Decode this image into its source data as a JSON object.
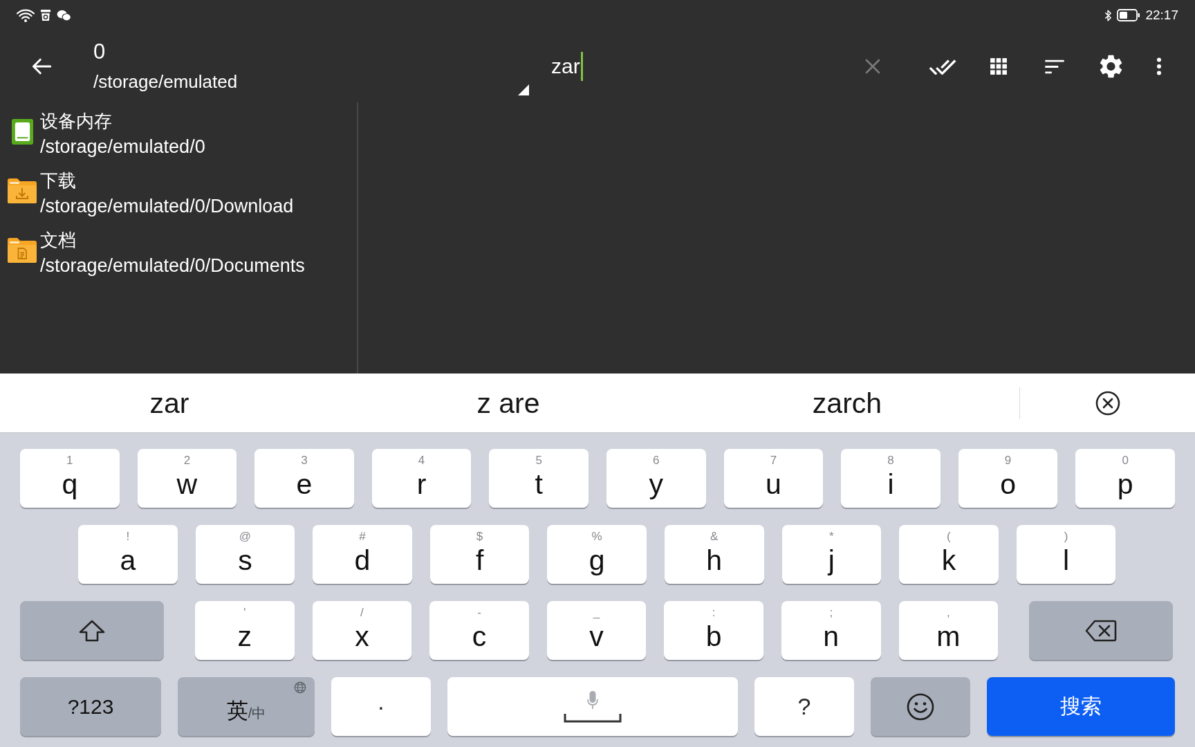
{
  "status_bar": {
    "time": "22:17"
  },
  "toolbar": {
    "title": "0",
    "subtitle": "/storage/emulated",
    "search": {
      "value": "zar"
    }
  },
  "sidebar": {
    "items": [
      {
        "kind": "storage",
        "title": "设备内存",
        "path": "/storage/emulated/0"
      },
      {
        "kind": "download",
        "title": "下载",
        "path": "/storage/emulated/0/Download"
      },
      {
        "kind": "documents",
        "title": "文档",
        "path": "/storage/emulated/0/Documents"
      }
    ]
  },
  "keyboard": {
    "suggestions": [
      "zar",
      "z are",
      "zarch"
    ],
    "rows": [
      [
        {
          "kind": "letter",
          "label": "q",
          "hint": "1"
        },
        {
          "kind": "letter",
          "label": "w",
          "hint": "2"
        },
        {
          "kind": "letter",
          "label": "e",
          "hint": "3"
        },
        {
          "kind": "letter",
          "label": "r",
          "hint": "4"
        },
        {
          "kind": "letter",
          "label": "t",
          "hint": "5"
        },
        {
          "kind": "letter",
          "label": "y",
          "hint": "6"
        },
        {
          "kind": "letter",
          "label": "u",
          "hint": "7"
        },
        {
          "kind": "letter",
          "label": "i",
          "hint": "8"
        },
        {
          "kind": "letter",
          "label": "o",
          "hint": "9"
        },
        {
          "kind": "letter",
          "label": "p",
          "hint": "0"
        }
      ],
      [
        {
          "kind": "letter",
          "label": "a",
          "hint": "!"
        },
        {
          "kind": "letter",
          "label": "s",
          "hint": "@"
        },
        {
          "kind": "letter",
          "label": "d",
          "hint": "#"
        },
        {
          "kind": "letter",
          "label": "f",
          "hint": "$"
        },
        {
          "kind": "letter",
          "label": "g",
          "hint": "%"
        },
        {
          "kind": "letter",
          "label": "h",
          "hint": "&"
        },
        {
          "kind": "letter",
          "label": "j",
          "hint": "*"
        },
        {
          "kind": "letter",
          "label": "k",
          "hint": "("
        },
        {
          "kind": "letter",
          "label": "l",
          "hint": ")"
        }
      ],
      [
        {
          "kind": "shift"
        },
        {
          "kind": "letter",
          "label": "z",
          "hint": "'"
        },
        {
          "kind": "letter",
          "label": "x",
          "hint": "/"
        },
        {
          "kind": "letter",
          "label": "c",
          "hint": "-"
        },
        {
          "kind": "letter",
          "label": "v",
          "hint": "_"
        },
        {
          "kind": "letter",
          "label": "b",
          "hint": ":"
        },
        {
          "kind": "letter",
          "label": "n",
          "hint": ";"
        },
        {
          "kind": "letter",
          "label": "m",
          "hint": ","
        },
        {
          "kind": "backspace"
        }
      ],
      [
        {
          "kind": "symbols",
          "label": "?123"
        },
        {
          "kind": "language",
          "label": "英",
          "secondary": "/中"
        },
        {
          "kind": "char",
          "label": "·"
        },
        {
          "kind": "space"
        },
        {
          "kind": "char",
          "label": "?"
        },
        {
          "kind": "emoji"
        },
        {
          "kind": "action",
          "label": "搜索"
        }
      ]
    ]
  }
}
